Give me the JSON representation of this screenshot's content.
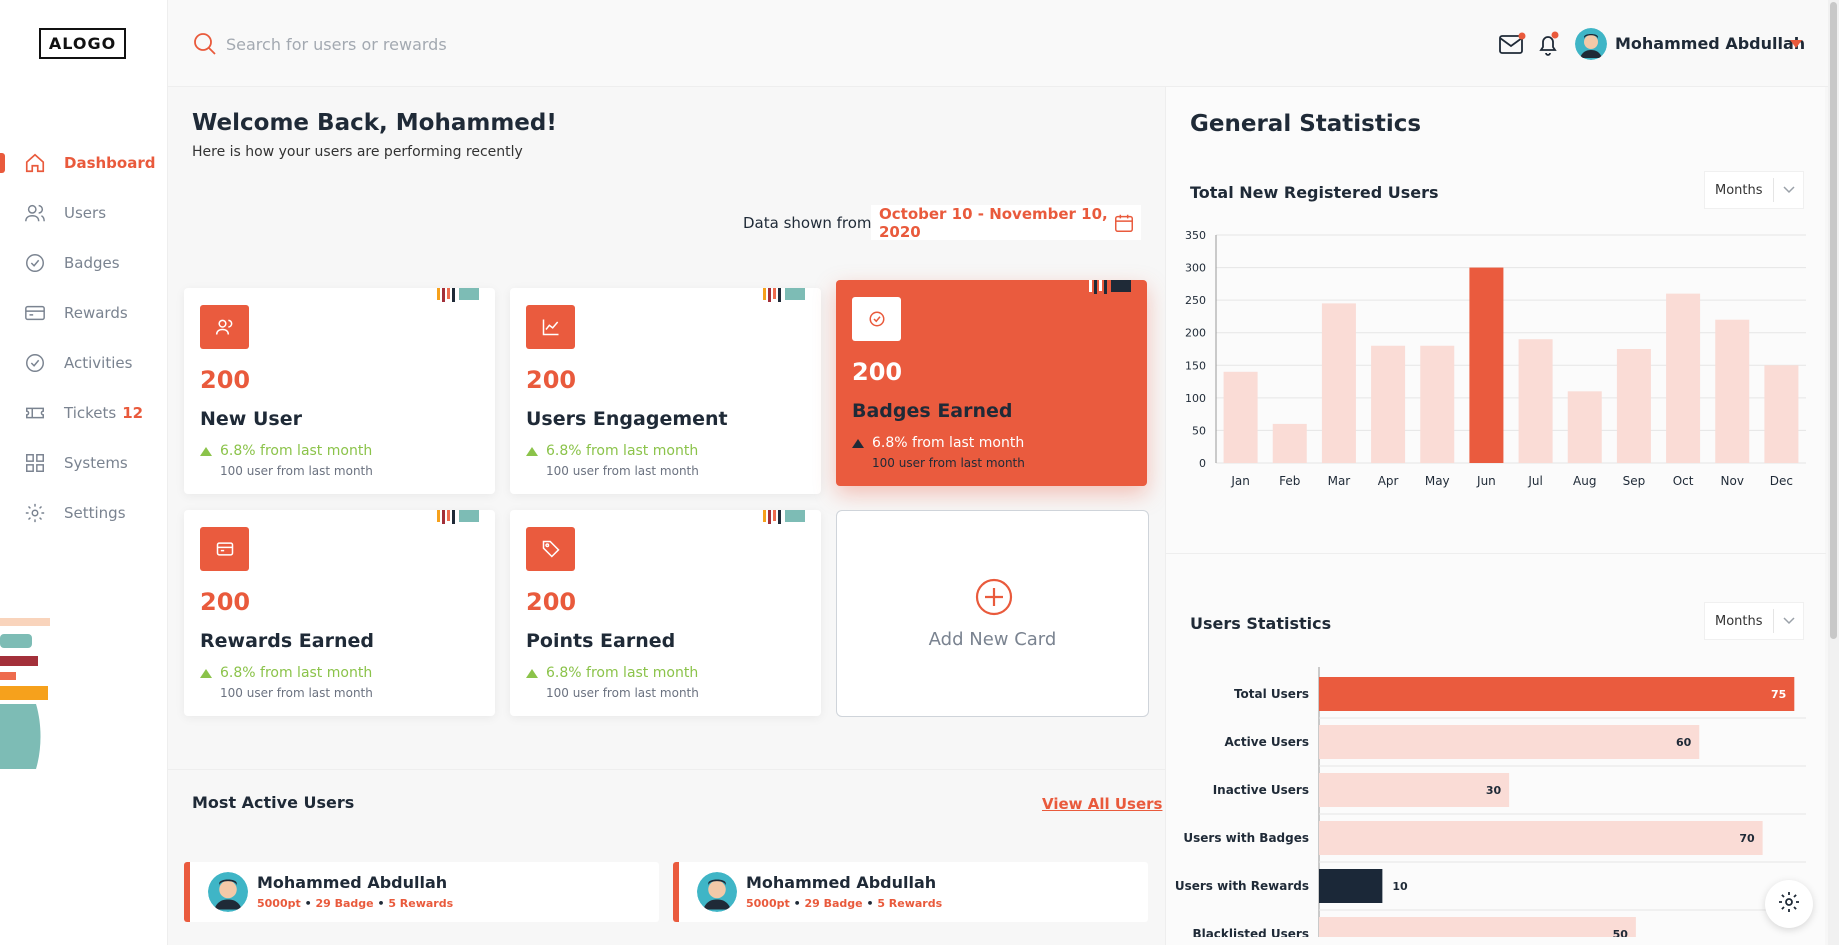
{
  "logo": "ALOGO",
  "sidebar": {
    "items": [
      {
        "label": "Dashboard",
        "icon": "home-icon",
        "active": true
      },
      {
        "label": "Users",
        "icon": "users-icon"
      },
      {
        "label": "Badges",
        "icon": "badge-check-icon"
      },
      {
        "label": "Rewards",
        "icon": "reward-card-icon"
      },
      {
        "label": "Activities",
        "icon": "activity-check-icon"
      },
      {
        "label": "Tickets",
        "icon": "ticket-icon",
        "badge": "12"
      },
      {
        "label": "Systems",
        "icon": "grid-icon"
      },
      {
        "label": "Settings",
        "icon": "gear-icon"
      }
    ]
  },
  "search": {
    "placeholder": "Search for users or rewards"
  },
  "header": {
    "user_name": "Mohammed Abdullah"
  },
  "welcome": {
    "title": "Welcome Back, Mohammed!",
    "subtitle": "Here is how your users are performing recently"
  },
  "date_range": {
    "label": "Data shown from:",
    "value": "October 10 - November 10, 2020"
  },
  "cards": [
    {
      "value": "200",
      "title": "New User",
      "change": "6.8% from last month",
      "sub": "100 user from last month",
      "icon": "users-icon"
    },
    {
      "value": "200",
      "title": "Users Engagement",
      "change": "6.8% from last month",
      "sub": "100 user from last month",
      "icon": "chart-line-icon"
    },
    {
      "value": "200",
      "title": "Badges Earned",
      "change": "6.8% from last month",
      "sub": "100 user from last month",
      "icon": "badge-check-icon",
      "highlight": true
    },
    {
      "value": "200",
      "title": "Rewards Earned",
      "change": "6.8% from last month",
      "sub": "100 user from last month",
      "icon": "reward-card-icon"
    },
    {
      "value": "200",
      "title": "Points Earned",
      "change": "6.8% from last month",
      "sub": "100 user from last month",
      "icon": "tag-icon"
    }
  ],
  "add_card": {
    "label": "Add New Card"
  },
  "most_active": {
    "title": "Most Active Users",
    "view_all": "View All Users",
    "users": [
      {
        "name": "Mohammed Abdullah",
        "points": "5000pt",
        "badges": "29 Badge",
        "rewards": "5 Rewards"
      },
      {
        "name": "Mohammed Abdullah",
        "points": "5000pt",
        "badges": "29 Badge",
        "rewards": "5 Rewards"
      }
    ]
  },
  "general_stats": {
    "title": "General Statistics",
    "new_users_title": "Total New Registered Users",
    "users_stats_title": "Users Statistics",
    "period_select": "Months"
  },
  "colors": {
    "accent": "#ea5b3e",
    "light_bar": "#fadcd6",
    "dark": "#1b2838",
    "positive": "#8bc34a"
  },
  "chart_data": [
    {
      "type": "bar",
      "title": "Total New Registered Users",
      "categories": [
        "Jan",
        "Feb",
        "Mar",
        "Apr",
        "May",
        "Jun",
        "Jul",
        "Aug",
        "Sep",
        "Oct",
        "Nov",
        "Dec"
      ],
      "values": [
        140,
        60,
        245,
        180,
        180,
        300,
        190,
        110,
        175,
        260,
        220,
        150
      ],
      "highlight_index": 5,
      "ylim": [
        0,
        350
      ],
      "yticks": [
        0,
        50,
        100,
        150,
        200,
        250,
        300,
        350
      ],
      "grid": true
    },
    {
      "type": "bar",
      "orientation": "horizontal",
      "title": "Users Statistics",
      "categories": [
        "Total Users",
        "Active Users",
        "Inactive Users",
        "Users with Badges",
        "Users with Rewards",
        "Blacklisted Users"
      ],
      "values": [
        75,
        60,
        30,
        70,
        10,
        50
      ],
      "xlim": [
        0,
        80
      ],
      "highlight_index": 0,
      "dark_index": 4
    }
  ]
}
